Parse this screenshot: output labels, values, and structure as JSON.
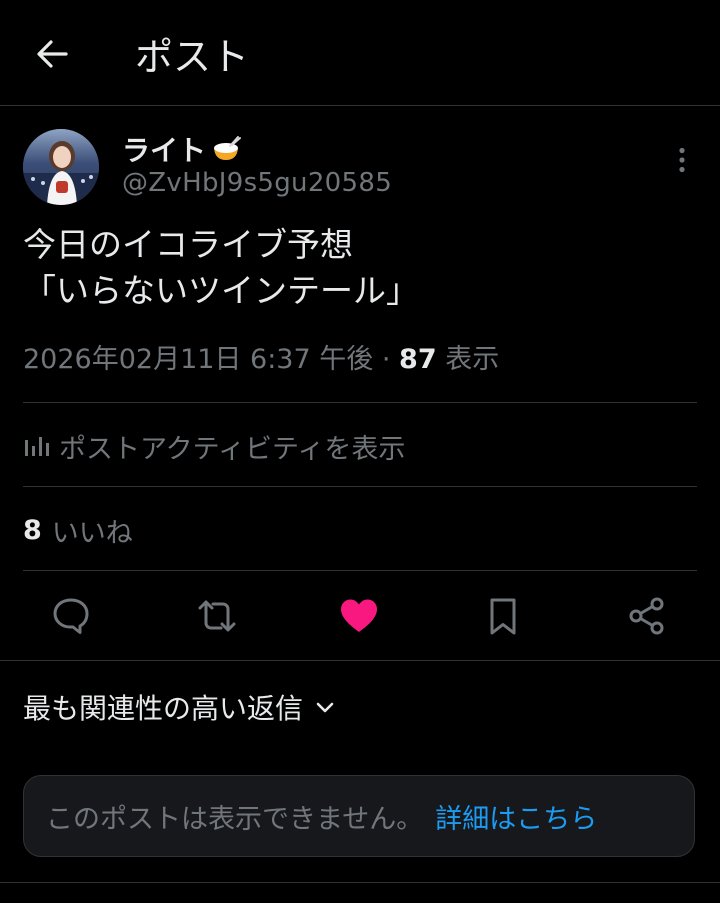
{
  "header": {
    "title": "ポスト",
    "back_icon": "arrow-left-icon"
  },
  "author": {
    "display_name": "ライト",
    "name_emoji": "rice-bowl-emoji",
    "handle": "@ZvHbJ9s5gu20585",
    "avatar": "profile-photo"
  },
  "post": {
    "text_lines": [
      "今日のイコライブ予想",
      "「いらないツインテール」"
    ],
    "date": "2026年02月11日",
    "time": "6:37 午後",
    "separator": "·",
    "views_count": "87",
    "views_label": "表示"
  },
  "activity": {
    "label": "ポストアクティビティを表示",
    "icon": "bar-chart-icon"
  },
  "likes": {
    "count": "8",
    "label": "いいね"
  },
  "actions": [
    {
      "name": "reply",
      "icon": "reply-icon"
    },
    {
      "name": "repost",
      "icon": "repost-icon"
    },
    {
      "name": "like",
      "icon": "heart-icon",
      "state": "liked"
    },
    {
      "name": "bookmark",
      "icon": "bookmark-icon"
    },
    {
      "name": "share",
      "icon": "share-icon"
    }
  ],
  "replies": {
    "sort_label": "最も関連性の高い返信",
    "sort_icon": "chevron-down-icon"
  },
  "notice": {
    "text": "このポストは表示できません。",
    "link": "詳細はこちら"
  },
  "colors": {
    "background": "#000000",
    "text_primary": "#e7e9ea",
    "text_secondary": "#71767b",
    "divider": "#2f3336",
    "like_active": "#f91880",
    "link": "#1d9bf0",
    "notice_bg": "#16181c"
  }
}
